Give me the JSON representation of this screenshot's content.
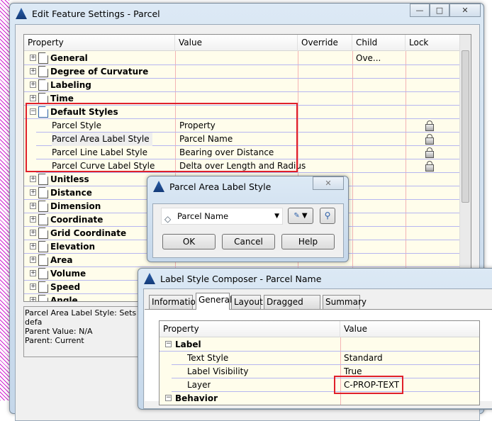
{
  "main_dialog": {
    "title": "Edit Feature Settings - Parcel",
    "columns": [
      "Property",
      "Value",
      "Override",
      "Child Ove...",
      "Lock"
    ],
    "categories_top": [
      "General",
      "Degree of Curvature",
      "Labeling",
      "Time"
    ],
    "default_styles": {
      "label": "Default Styles",
      "rows": [
        {
          "property": "Parcel Style",
          "value": "Property"
        },
        {
          "property": "Parcel Area Label Style",
          "value": "Parcel Name"
        },
        {
          "property": "Parcel Line Label Style",
          "value": "Bearing over Distance"
        },
        {
          "property": "Parcel Curve Label Style",
          "value": "Delta over Length and Radius"
        }
      ]
    },
    "categories_bottom": [
      "Unitless",
      "Distance",
      "Dimension",
      "Coordinate",
      "Grid Coordinate",
      "Elevation",
      "Area",
      "Volume",
      "Speed",
      "Angle"
    ],
    "description": [
      "Parcel Area Label Style: Sets defa",
      "Parent Value: N/A",
      "Parent: Current"
    ]
  },
  "area_dialog": {
    "title": "Parcel Area Label Style",
    "selected_style": "Parcel Name",
    "ok": "OK",
    "cancel": "Cancel",
    "help": "Help"
  },
  "composer": {
    "title": "Label Style Composer - Parcel Name",
    "tabs": [
      "Information",
      "General",
      "Layout",
      "Dragged State",
      "Summary"
    ],
    "active_tab": "General",
    "columns": [
      "Property",
      "Value"
    ],
    "group": "Label",
    "rows": [
      {
        "property": "Text Style",
        "value": "Standard"
      },
      {
        "property": "Label Visibility",
        "value": "True"
      },
      {
        "property": "Layer",
        "value": "C-PROP-TEXT"
      }
    ],
    "group2": "Behavior"
  },
  "colors": {
    "highlight": "#e0202a",
    "grid_bg": "#fffdeb"
  }
}
